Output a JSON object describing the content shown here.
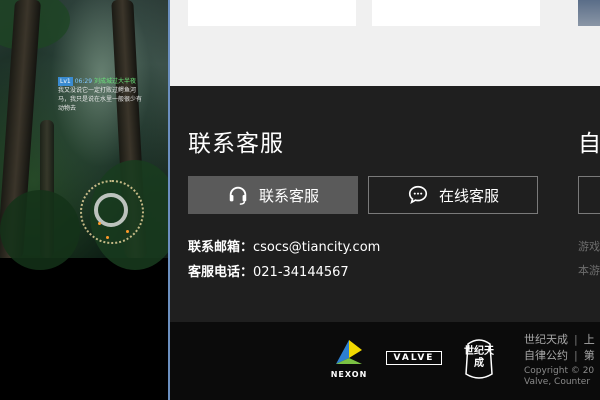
{
  "game_overlay": {
    "tag": "Lv1",
    "time": "06:29",
    "speaker": "刘成城过大半夜",
    "line1": "我又没说它一定打败过鳄鱼河",
    "line2": "马，我只是说在水里一般很少有",
    "line3": "动物去"
  },
  "support": {
    "title": "联系客服",
    "contact_button": "联系客服",
    "online_button": "在线客服",
    "email_label": "联系邮箱：",
    "email_value": "csocs@tiancity.com",
    "phone_label": "客服电话：",
    "phone_value": "021-34144567",
    "contact_icon": "headset-icon",
    "online_icon": "chat-bubble-icon"
  },
  "side": {
    "title": "自",
    "text1": "游戏",
    "text2": "本游"
  },
  "footer": {
    "nexon": "NEXON",
    "valve": "VALVE",
    "tiancity_logo_text": "世纪天成",
    "link1": "世纪天成",
    "sep1": "|",
    "link1b": "上",
    "link2": "自律公约",
    "sep2": "|",
    "link2b": "第",
    "copy1": "Copyright © 20",
    "copy2": "Valve, Counter"
  },
  "colors": {
    "panel_bg": "#1f1f1f",
    "footer_bg": "#0b0b0b",
    "button_active": "#5a5a5a",
    "accent_border": "#6b8fbf"
  }
}
